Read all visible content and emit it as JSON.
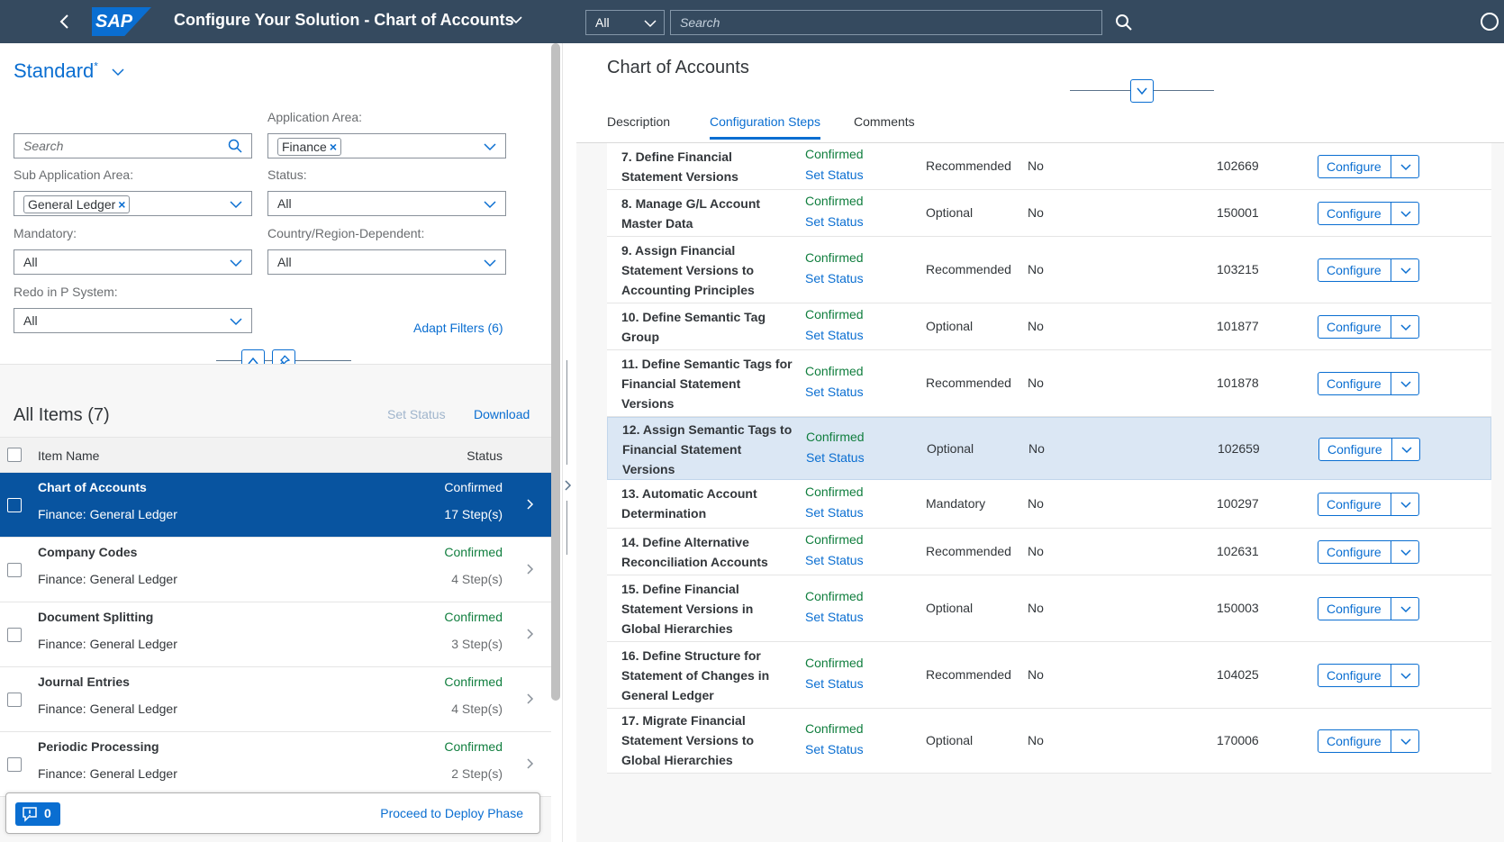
{
  "shell": {
    "logo": "SAP",
    "title": "Configure Your Solution - Chart of Accounts",
    "search_scope": "All",
    "search_placeholder": "Search"
  },
  "filters": {
    "variant": "Standard",
    "variant_marker": "*",
    "search_placeholder": "Search",
    "application_area_label": "Application Area:",
    "application_area_token": "Finance",
    "sub_application_area_label": "Sub Application Area:",
    "sub_application_area_token": "General Ledger",
    "status_label": "Status:",
    "status_value": "All",
    "mandatory_label": "Mandatory:",
    "mandatory_value": "All",
    "country_label": "Country/Region-Dependent:",
    "country_value": "All",
    "redo_label": "Redo in P System:",
    "redo_value": "All",
    "adapt_filters": "Adapt Filters (6)"
  },
  "items": {
    "title": "All Items (7)",
    "set_status": "Set Status",
    "download": "Download",
    "col_name": "Item Name",
    "col_status": "Status",
    "list": [
      {
        "name": "Chart of Accounts",
        "sub": "Finance: General Ledger",
        "status": "Confirmed",
        "steps": "17 Step(s)"
      },
      {
        "name": "Company Codes",
        "sub": "Finance: General Ledger",
        "status": "Confirmed",
        "steps": "4 Step(s)"
      },
      {
        "name": "Document Splitting",
        "sub": "Finance: General Ledger",
        "status": "Confirmed",
        "steps": "3 Step(s)"
      },
      {
        "name": "Journal Entries",
        "sub": "Finance: General Ledger",
        "status": "Confirmed",
        "steps": "4 Step(s)"
      },
      {
        "name": "Periodic Processing",
        "sub": "Finance: General Ledger",
        "status": "Confirmed",
        "steps": "2 Step(s)"
      }
    ]
  },
  "footer": {
    "message_count": "0",
    "proceed": "Proceed to Deploy Phase"
  },
  "detail": {
    "title": "Chart of Accounts",
    "tabs": [
      "Description",
      "Configuration Steps",
      "Comments"
    ],
    "steps": [
      {
        "name": "7. Define Financial Statement Versions",
        "status": "Confirmed",
        "set_status": "Set Status",
        "type": "Recommended",
        "redo": "No",
        "id": "102669",
        "action": "Configure"
      },
      {
        "name": "8. Manage G/L Account Master Data",
        "status": "Confirmed",
        "set_status": "Set Status",
        "type": "Optional",
        "redo": "No",
        "id": "150001",
        "action": "Configure"
      },
      {
        "name": "9. Assign Financial Statement Versions to Accounting Principles",
        "status": "Confirmed",
        "set_status": "Set Status",
        "type": "Recommended",
        "redo": "No",
        "id": "103215",
        "action": "Configure"
      },
      {
        "name": "10. Define Semantic Tag Group",
        "status": "Confirmed",
        "set_status": "Set Status",
        "type": "Optional",
        "redo": "No",
        "id": "101877",
        "action": "Configure"
      },
      {
        "name": "11. Define Semantic Tags for Financial Statement Versions",
        "status": "Confirmed",
        "set_status": "Set Status",
        "type": "Recommended",
        "redo": "No",
        "id": "101878",
        "action": "Configure"
      },
      {
        "name": "12. Assign Semantic Tags to Financial Statement Versions",
        "status": "Confirmed",
        "set_status": "Set Status",
        "type": "Optional",
        "redo": "No",
        "id": "102659",
        "action": "Configure"
      },
      {
        "name": "13. Automatic Account Determination",
        "status": "Confirmed",
        "set_status": "Set Status",
        "type": "Mandatory",
        "redo": "No",
        "id": "100297",
        "action": "Configure"
      },
      {
        "name": "14. Define Alternative Reconciliation Accounts",
        "status": "Confirmed",
        "set_status": "Set Status",
        "type": "Recommended",
        "redo": "No",
        "id": "102631",
        "action": "Configure"
      },
      {
        "name": "15. Define Financial Statement Versions in Global Hierarchies",
        "status": "Confirmed",
        "set_status": "Set Status",
        "type": "Optional",
        "redo": "No",
        "id": "150003",
        "action": "Configure"
      },
      {
        "name": "16. Define Structure for Statement of Changes in General Ledger",
        "status": "Confirmed",
        "set_status": "Set Status",
        "type": "Recommended",
        "redo": "No",
        "id": "104025",
        "action": "Configure"
      },
      {
        "name": "17. Migrate Financial Statement Versions to Global Hierarchies",
        "status": "Confirmed",
        "set_status": "Set Status",
        "type": "Optional",
        "redo": "No",
        "id": "170006",
        "action": "Configure"
      }
    ]
  },
  "colors": {
    "shell": "#354a5f",
    "accent": "#0a6ed1",
    "selected": "#0854a0",
    "positive": "#107e3e",
    "highlight_row": "#dbe7f4"
  }
}
